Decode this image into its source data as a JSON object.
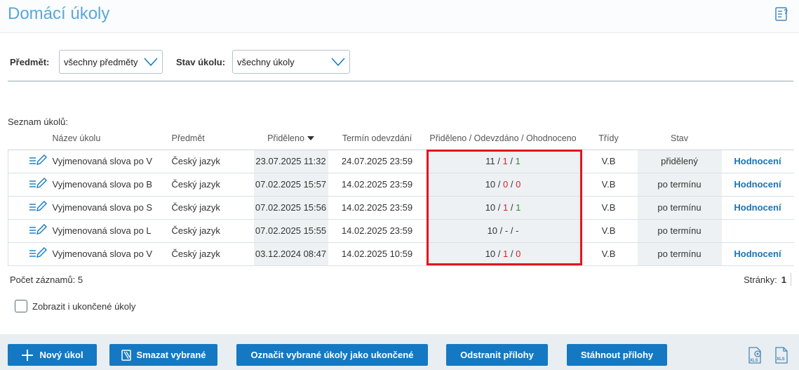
{
  "page": {
    "title": "Domácí úkoly"
  },
  "filters": {
    "subject_label": "Předmět:",
    "subject_value": "všechny předměty",
    "status_label": "Stav úkolu:",
    "status_value": "všechny úkoly"
  },
  "list": {
    "label": "Seznam úkolů:",
    "columns": {
      "name": "Název úkolu",
      "subject": "Předmět",
      "assigned": "Přiděleno",
      "deadline": "Termín odevzdání",
      "counts": "Přiděleno / Odevzdáno / Ohodnoceno",
      "classes": "Třídy",
      "status": "Stav"
    },
    "rows": [
      {
        "name": "Vyjmenovaná slova po V",
        "subject": "Český jazyk",
        "assigned": "23.07.2025 11:32",
        "deadline": "24.07.2025 23:59",
        "c_total": "11",
        "c_sub": "1",
        "c_eval": "1",
        "classes": "V.B",
        "status": "přidělený",
        "action": "Hodnocení"
      },
      {
        "name": "Vyjmenovaná slova po B",
        "subject": "Český jazyk",
        "assigned": "07.02.2025 15:57",
        "deadline": "14.02.2025 23:59",
        "c_total": "10",
        "c_sub": "0",
        "c_eval": "0",
        "classes": "V.B",
        "status": "po termínu",
        "action": "Hodnocení"
      },
      {
        "name": "Vyjmenovaná slova po S",
        "subject": "Český jazyk",
        "assigned": "07.02.2025 15:56",
        "deadline": "14.02.2025 23:59",
        "c_total": "10",
        "c_sub": "1",
        "c_eval": "1",
        "classes": "V.B",
        "status": "po termínu",
        "action": "Hodnocení"
      },
      {
        "name": "Vyjmenovaná slova po L",
        "subject": "Český jazyk",
        "assigned": "07.02.2025 15:55",
        "deadline": "14.02.2025 23:59",
        "c_total": "10",
        "c_sub": "-",
        "c_eval": "-",
        "classes": "V.B",
        "status": "po termínu",
        "action": ""
      },
      {
        "name": "Vyjmenovaná slova po V",
        "subject": "Český jazyk",
        "assigned": "03.12.2024 08:47",
        "deadline": "14.02.2025 10:59",
        "c_total": "10",
        "c_sub": "1",
        "c_eval": "0",
        "classes": "V.B",
        "status": "po termínu",
        "action": "Hodnocení"
      }
    ],
    "record_count": "Počet záznamů: 5",
    "pages_label": "Stránky:",
    "page_current": "1"
  },
  "show_finished_label": "Zobrazit i ukončené úkoly",
  "buttons": {
    "new": "Nový úkol",
    "delete": "Smazat vybrané",
    "mark_done": "Označit vybrané úkoly jako ukončené",
    "remove_att": "Odstranit přílohy",
    "download_att": "Stáhnout přílohy"
  },
  "colors": {
    "accent": "#1479c2",
    "title": "#5aa8d8",
    "red": "#d8232a",
    "green": "#2c8a2c"
  }
}
